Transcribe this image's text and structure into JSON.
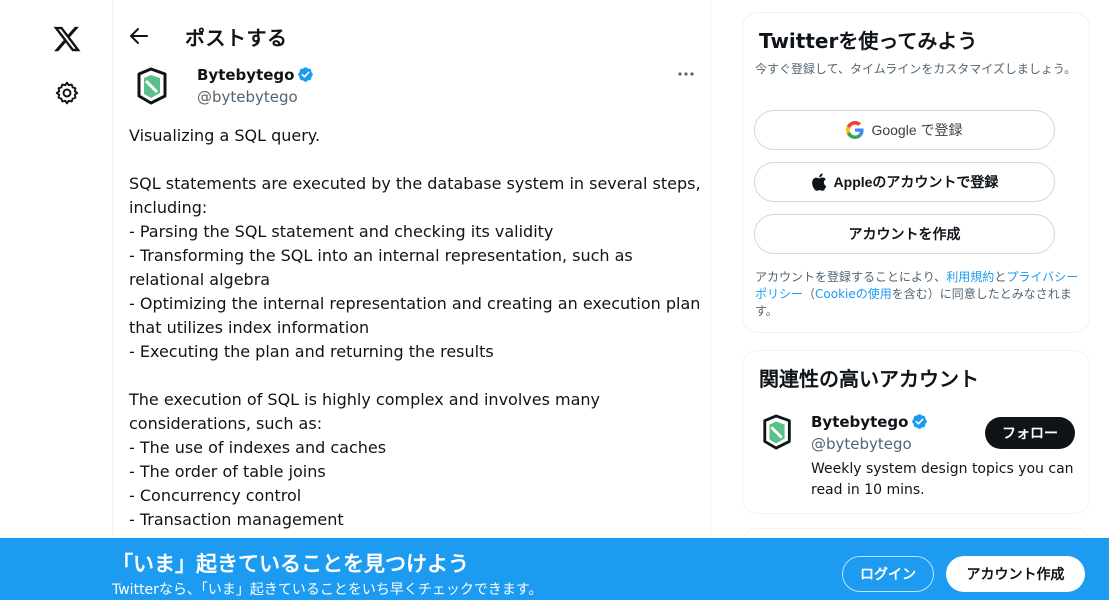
{
  "nav": {
    "logo_icon": "x-logo-icon",
    "settings_icon": "gear-icon"
  },
  "header": {
    "title": "ポストする",
    "back_icon": "arrow-left-icon"
  },
  "post": {
    "author_name": "Bytebytego",
    "author_handle": "@bytebytego",
    "verified": true,
    "more_icon": "ellipsis-icon",
    "lines": [
      "Visualizing a SQL query.",
      "",
      "SQL statements are executed by the database system in several steps, including:",
      "- Parsing the SQL statement and checking its validity",
      "- Transforming the SQL into an internal representation, such as relational algebra",
      "- Optimizing the internal representation and creating an execution plan that utilizes index information",
      "- Executing the plan and returning the results",
      "",
      "The execution of SQL is highly complex and involves many considerations, such as:",
      "- The use of indexes and caches",
      "- The order of table joins",
      "- Concurrency control",
      "- Transaction management"
    ]
  },
  "signup_card": {
    "title": "Twitterを使ってみよう",
    "subtitle": "今すぐ登録して、タイムラインをカスタマイズしましょう。",
    "google_label": "Google で登録",
    "apple_label": "Appleのアカウントで登録",
    "create_label": "アカウントを作成",
    "legal_prefix": "アカウントを登録することにより、",
    "terms_link": "利用規約",
    "legal_and": "と",
    "privacy_link": "プライバシーポリシー",
    "legal_paren_open": "（",
    "cookie_link": "Cookieの使用",
    "legal_suffix": "を含む）に同意したとみなされます。"
  },
  "related": {
    "title": "関連性の高いアカウント",
    "name": "Bytebytego",
    "handle": "@bytebytego",
    "bio": "Weekly system design topics you can read in 10 mins.",
    "follow_label": "フォロー"
  },
  "banner": {
    "title": "「いま」起きていることを見つけよう",
    "subtitle": "Twitterなら、「いま」起きていることをいち早くチェックできます。",
    "login_label": "ログイン",
    "signup_label": "アカウント作成"
  },
  "colors": {
    "accent": "#1d9bf0",
    "text": "#0f1419",
    "secondary": "#536471",
    "logo_green": "#5bbf8a"
  }
}
